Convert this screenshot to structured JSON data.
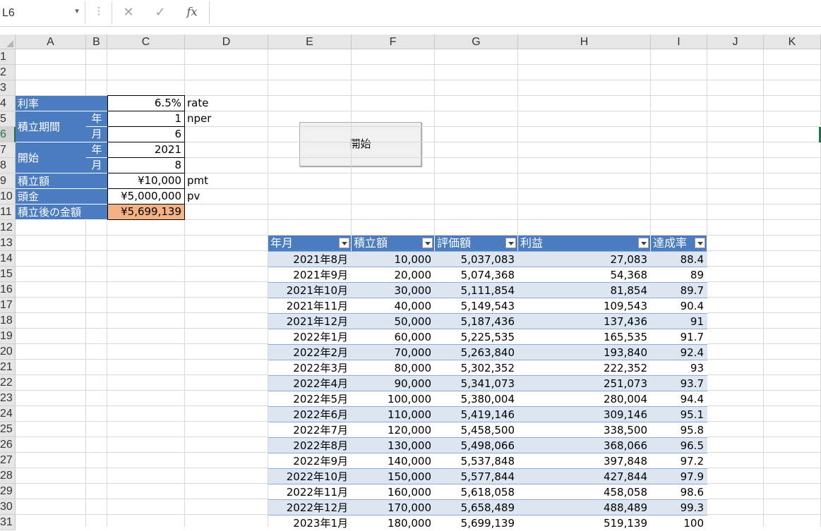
{
  "formula_bar": {
    "name_box": "L6",
    "cancel": "✕",
    "enter": "✓",
    "fx": "fx",
    "content": ""
  },
  "columns": [
    "A",
    "B",
    "C",
    "D",
    "E",
    "F",
    "G",
    "H",
    "I",
    "J",
    "K"
  ],
  "rows": [
    "1",
    "2",
    "3",
    "4",
    "5",
    "6",
    "7",
    "8",
    "9",
    "10",
    "11",
    "12",
    "13",
    "14",
    "15",
    "16",
    "17",
    "18",
    "19",
    "20",
    "21",
    "22",
    "23",
    "24",
    "25",
    "26",
    "27",
    "28",
    "29",
    "30",
    "31"
  ],
  "selected_cell": {
    "column": "L",
    "row": "6"
  },
  "params": {
    "rate_label": "利率",
    "rate_value": "6.5%",
    "rate_note": "rate",
    "period_label": "積立期間",
    "period_year_unit": "年",
    "period_year_value": "1",
    "period_note": "nper",
    "period_month_unit": "月",
    "period_month_value": "6",
    "start_label": "開始",
    "start_year_unit": "年",
    "start_year_value": "2021",
    "start_month_unit": "月",
    "start_month_value": "8",
    "pmt_label": "積立額",
    "pmt_value": "¥10,000",
    "pmt_note": "pmt",
    "pv_label": "頭金",
    "pv_value": "¥5,000,000",
    "pv_note": "pv",
    "fv_label": "積立後の金額",
    "fv_value": "¥5,699,139",
    "fv_highlight_color": "#f4b183",
    "label_color": "#4a7cbf"
  },
  "start_button": {
    "label": "開始"
  },
  "table": {
    "headers": [
      "年月",
      "積立額",
      "評価額",
      "利益",
      "達成率"
    ],
    "band_color": "#dce6f1",
    "rows": [
      [
        "2021年8月",
        "10,000",
        "5,037,083",
        "27,083",
        "88.4"
      ],
      [
        "2021年9月",
        "20,000",
        "5,074,368",
        "54,368",
        "89"
      ],
      [
        "2021年10月",
        "30,000",
        "5,111,854",
        "81,854",
        "89.7"
      ],
      [
        "2021年11月",
        "40,000",
        "5,149,543",
        "109,543",
        "90.4"
      ],
      [
        "2021年12月",
        "50,000",
        "5,187,436",
        "137,436",
        "91"
      ],
      [
        "2022年1月",
        "60,000",
        "5,225,535",
        "165,535",
        "91.7"
      ],
      [
        "2022年2月",
        "70,000",
        "5,263,840",
        "193,840",
        "92.4"
      ],
      [
        "2022年3月",
        "80,000",
        "5,302,352",
        "222,352",
        "93"
      ],
      [
        "2022年4月",
        "90,000",
        "5,341,073",
        "251,073",
        "93.7"
      ],
      [
        "2022年5月",
        "100,000",
        "5,380,004",
        "280,004",
        "94.4"
      ],
      [
        "2022年6月",
        "110,000",
        "5,419,146",
        "309,146",
        "95.1"
      ],
      [
        "2022年7月",
        "120,000",
        "5,458,500",
        "338,500",
        "95.8"
      ],
      [
        "2022年8月",
        "130,000",
        "5,498,066",
        "368,066",
        "96.5"
      ],
      [
        "2022年9月",
        "140,000",
        "5,537,848",
        "397,848",
        "97.2"
      ],
      [
        "2022年10月",
        "150,000",
        "5,577,844",
        "427,844",
        "97.9"
      ],
      [
        "2022年11月",
        "160,000",
        "5,618,058",
        "458,058",
        "98.6"
      ],
      [
        "2022年12月",
        "170,000",
        "5,658,489",
        "488,489",
        "99.3"
      ],
      [
        "2023年1月",
        "180,000",
        "5,699,139",
        "519,139",
        "100"
      ]
    ]
  }
}
